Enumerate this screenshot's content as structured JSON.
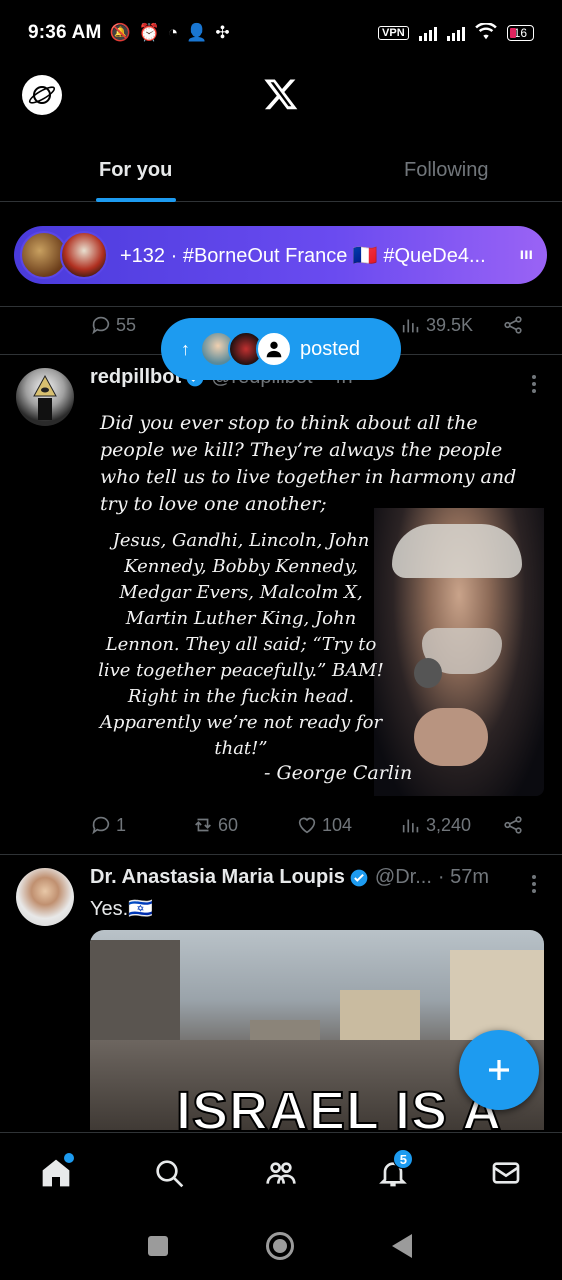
{
  "status_bar": {
    "time": "9:36 AM",
    "left_icons": [
      "mute-icon",
      "alarm-icon",
      "whatsapp-icon",
      "add-user-icon",
      "app-icon"
    ],
    "vpn": "VPN",
    "battery": "16"
  },
  "header": {
    "logo": "X"
  },
  "tabs": [
    {
      "label": "For you",
      "active": true
    },
    {
      "label": "Following",
      "active": false
    }
  ],
  "trend_pill": {
    "text": "+132 · #BorneOut France 🇫🇷 #QueDe4...",
    "more": "ııı"
  },
  "prev_post_actions": {
    "replies": "55",
    "views": "39.5K"
  },
  "posted_pill": {
    "label": "posted"
  },
  "post1": {
    "name": "redpillbot",
    "handle": "@redpillbot · 4h",
    "image": {
      "quote_intro": "Did you ever stop to think about all the people we kill? They’re always the people who tell us to live together in harmony and try to love one another;",
      "quote_body": "Jesus, Gandhi, Lincoln, John Kennedy, Bobby Kennedy, Medgar Evers, Malcolm X, Martin Luther King, John Lennon. They all said; “Try to live together peacefully.” BAM! Right in the fuckin head. Apparently we’re not ready for that!”",
      "attribution": "- George Carlin"
    },
    "actions": {
      "replies": "1",
      "reposts": "60",
      "likes": "104",
      "views": "3,240"
    }
  },
  "post2": {
    "name": "Dr. Anastasia Maria Loupis",
    "handle": "@Dr...",
    "time": "· 57m",
    "text": "Yes.🇮🇱",
    "image_caption": "ISRAEL IS A"
  },
  "nav": {
    "notifications_badge": "5"
  },
  "colors": {
    "accent": "#1d9bf0",
    "background": "#000000",
    "muted": "#71767b",
    "pill_gradient_start": "#4a3bdc",
    "pill_gradient_end": "#9a63f5"
  }
}
